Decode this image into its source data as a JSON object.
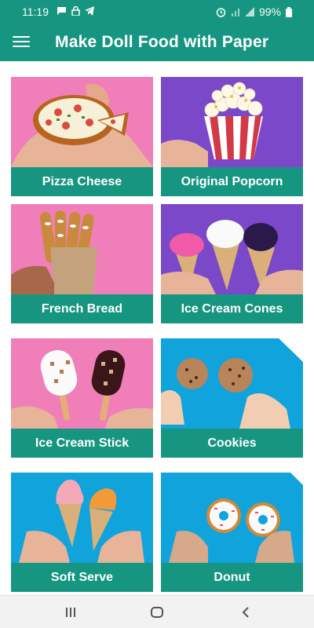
{
  "status_bar": {
    "time": "11:19",
    "battery": "99%"
  },
  "app_bar": {
    "title": "Make Doll Food with Paper"
  },
  "cards": [
    {
      "label": "Pizza Cheese"
    },
    {
      "label": "Original Popcorn"
    },
    {
      "label": "French Bread"
    },
    {
      "label": "Ice Cream Cones"
    },
    {
      "label": "Ice Cream Stick"
    },
    {
      "label": "Cookies"
    },
    {
      "label": "Soft Serve"
    },
    {
      "label": "Donut"
    }
  ],
  "colors": {
    "primary": "#169581",
    "pink_bg": "#f07fb9",
    "purple_bg": "#7a48c8",
    "blue_bg": "#10a3dc"
  },
  "nav_bar": {
    "icons": [
      "recent-apps-icon",
      "home-icon",
      "back-icon"
    ]
  }
}
